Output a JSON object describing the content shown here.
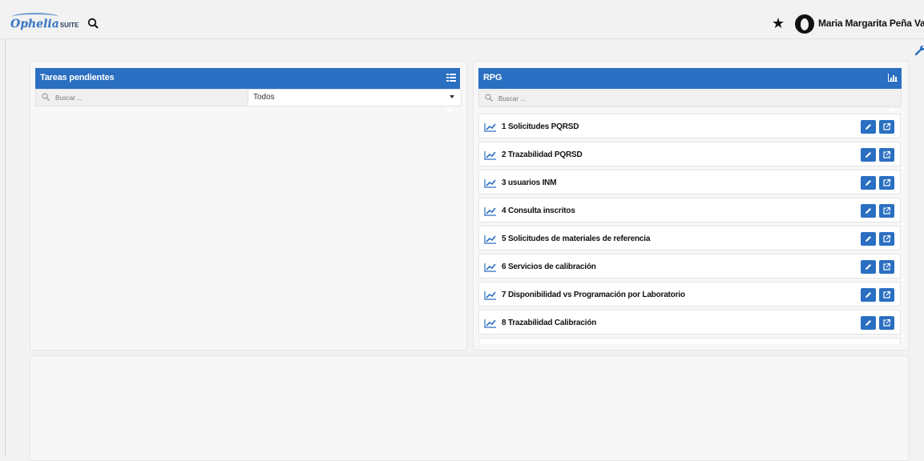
{
  "topbar": {
    "logo_main": "Ophelia",
    "logo_suite": "SUITE",
    "user_name": "Maria Margarita Peña Vargas"
  },
  "left_panel": {
    "title": "Tareas pendientes",
    "search_placeholder": "Buscar ...",
    "filter_value": "Todos"
  },
  "right_panel": {
    "title": "RPG",
    "search_placeholder": "Buscar ...",
    "items": [
      {
        "label": "1 Solicitudes PQRSD"
      },
      {
        "label": "2 Trazabilidad PQRSD"
      },
      {
        "label": "3 usuarios INM"
      },
      {
        "label": "4 Consulta inscritos"
      },
      {
        "label": "5 Solicitudes de materiales de referencia"
      },
      {
        "label": "6 Servicios de calibración"
      },
      {
        "label": "7 Disponibilidad vs Programación por Laboratorio"
      },
      {
        "label": "8 Trazabilidad Calibración"
      }
    ]
  },
  "colors": {
    "accent": "#2a6fc1",
    "background": "#f2f2f2"
  },
  "icons": [
    "search-icon",
    "star-icon",
    "avatar-icon",
    "chevron-down-icon",
    "wrench-icon",
    "list-icon",
    "bar-chart-icon",
    "line-chart-icon",
    "pencil-icon",
    "external-link-icon"
  ]
}
